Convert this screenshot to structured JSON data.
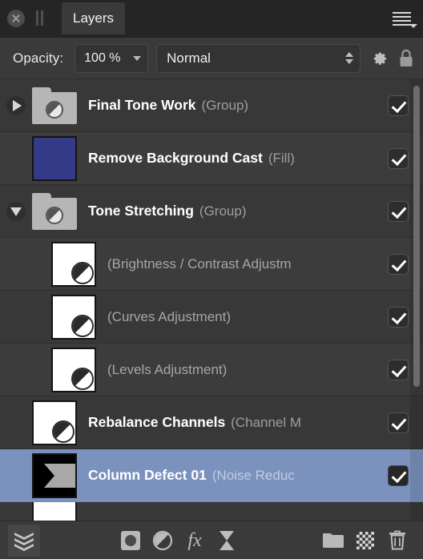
{
  "panel": {
    "tab_label": "Layers",
    "close_icon": "close-icon",
    "grip_icon": "pause-grip-icon",
    "menu_icon": "hamburger-menu-icon"
  },
  "options": {
    "opacity_label": "Opacity:",
    "opacity_value": "100 %",
    "blend_mode": "Normal",
    "gear_icon": "gear-icon",
    "lock_icon": "lock-icon"
  },
  "layers": [
    {
      "name": "Final Tone Work",
      "type": "(Group)",
      "kind": "group",
      "expanded": false,
      "twisty": "triangle-right",
      "indent": 0,
      "visible": true,
      "selected": false,
      "thumb": "folder-adjustment"
    },
    {
      "name": "Remove Background Cast",
      "type": "(Fill)",
      "kind": "fill",
      "twisty": "none",
      "indent": 1,
      "visible": true,
      "selected": false,
      "thumb": "solid-color",
      "thumb_color": "#343a85"
    },
    {
      "name": "Tone Stretching",
      "type": "(Group)",
      "kind": "group",
      "expanded": true,
      "twisty": "triangle-down",
      "indent": 0,
      "visible": true,
      "selected": false,
      "thumb": "folder-adjustment"
    },
    {
      "name": "",
      "type": "(Brightness / Contrast Adjustm",
      "kind": "adjustment",
      "twisty": "none",
      "indent": 2,
      "visible": true,
      "selected": false,
      "thumb": "white-adjustment"
    },
    {
      "name": "",
      "type": "(Curves Adjustment)",
      "kind": "adjustment",
      "twisty": "none",
      "indent": 2,
      "visible": true,
      "selected": false,
      "thumb": "white-adjustment"
    },
    {
      "name": "",
      "type": "(Levels Adjustment)",
      "kind": "adjustment",
      "twisty": "none",
      "indent": 2,
      "visible": true,
      "selected": false,
      "thumb": "white-adjustment"
    },
    {
      "name": "Rebalance Channels",
      "type": "(Channel M",
      "kind": "adjustment",
      "twisty": "none",
      "indent": 1,
      "visible": true,
      "selected": false,
      "thumb": "white-adjustment"
    },
    {
      "name": "Column Defect 01",
      "type": "(Noise Reduc",
      "kind": "filter",
      "twisty": "none",
      "indent": 1,
      "visible": true,
      "selected": true,
      "thumb": "black-hourglass"
    }
  ],
  "toolbar": {
    "buttons": [
      {
        "icon": "layers-stack-icon",
        "label": "Layers",
        "active": true
      },
      {
        "icon": "mask-icon",
        "label": "Add Mask",
        "active": false
      },
      {
        "icon": "adjustment-icon",
        "label": "Add Adjustment",
        "active": false
      },
      {
        "icon": "fx-icon",
        "label": "Effects",
        "active": false
      },
      {
        "icon": "hourglass-filter-icon",
        "label": "Add Filter",
        "active": false
      },
      {
        "icon": "folder-icon",
        "label": "New Group",
        "active": false
      },
      {
        "icon": "checker-new-layer-icon",
        "label": "New Layer",
        "active": false
      },
      {
        "icon": "trash-icon",
        "label": "Delete Layer",
        "active": false
      }
    ],
    "fx_label": "fx"
  },
  "colors": {
    "panel_bg": "#3a3a3a",
    "tabbar_bg": "#252525",
    "row_bg": "#383838",
    "row_alt_bg": "#3c3c3c",
    "selection": "#7a92bd",
    "fill_thumb": "#343a85",
    "text": "#ffffff",
    "muted_text": "#9e9e9e"
  },
  "scroll": {
    "thumb_top_pct": 2,
    "thumb_height_pct": 68
  }
}
